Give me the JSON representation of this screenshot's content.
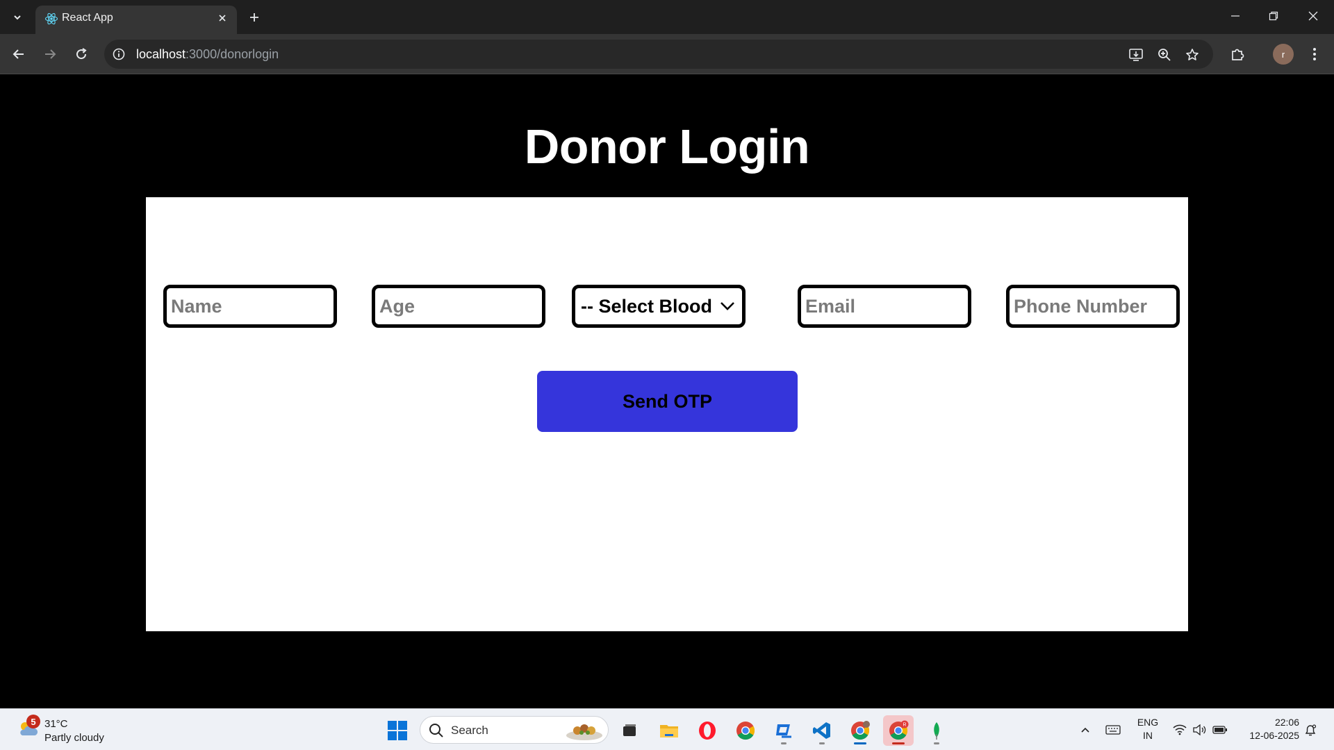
{
  "browser": {
    "tab_title": "React App",
    "url_host": "localhost",
    "url_rest": ":3000/donorlogin"
  },
  "page": {
    "title": "Donor Login",
    "form": {
      "name_placeholder": "Name",
      "age_placeholder": "Age",
      "blood_select_value": "-- Select Blood",
      "email_placeholder": "Email",
      "phone_placeholder": "Phone Number",
      "submit_label": "Send OTP"
    },
    "colors": {
      "background": "#000000",
      "card": "#ffffff",
      "button": "#3535db"
    }
  },
  "taskbar": {
    "weather_badge": "5",
    "weather_temp": "31°C",
    "weather_condition": "Partly cloudy",
    "search_label": "Search",
    "lang_line1": "ENG",
    "lang_line2": "IN",
    "time": "22:06",
    "date": "12-06-2025",
    "chrome_profile_badge": "R",
    "apps": [
      "start-icon",
      "search",
      "task-view-icon",
      "file-explorer-icon",
      "opera-icon",
      "chrome-icon",
      "copilot-icon",
      "vscode-icon",
      "chrome-profile-icon",
      "chrome-active-icon",
      "mongodb-icon"
    ]
  }
}
